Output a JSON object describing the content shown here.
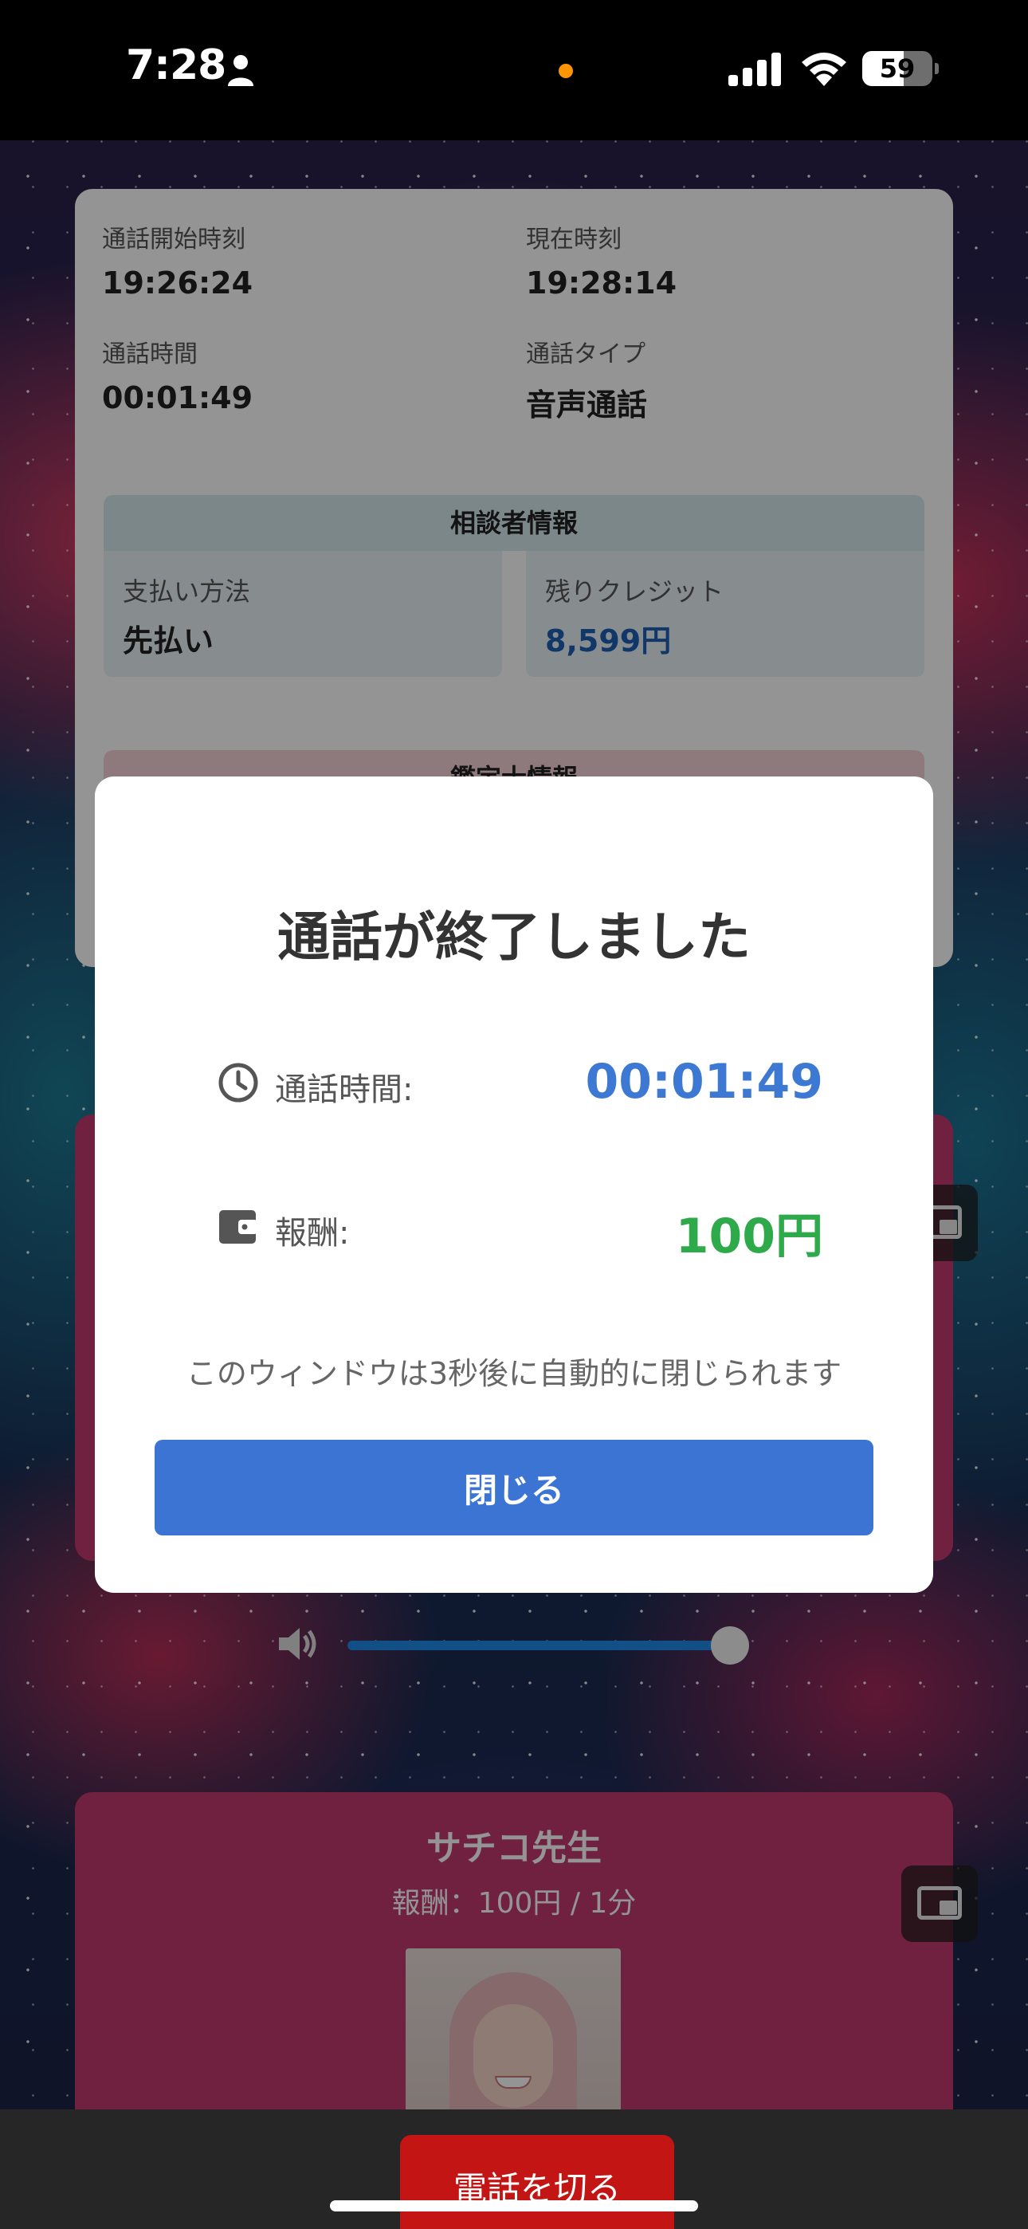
{
  "status_bar": {
    "time": "7:28",
    "battery_percent": "59",
    "battery_level": 0.59
  },
  "call_info": {
    "start_time_label": "通話開始時刻",
    "start_time": "19:26:24",
    "current_time_label": "現在時刻",
    "current_time": "19:28:14",
    "duration_label": "通話時間",
    "duration": "00:01:49",
    "type_label": "通話タイプ",
    "type": "音声通話"
  },
  "consultant_info": {
    "heading": "相談者情報",
    "payment_label": "支払い方法",
    "payment_value": "先払い",
    "credit_label": "残りクレジット",
    "credit_value": "8,599円",
    "credit_color": "#1e5fb4"
  },
  "appraiser_info": {
    "heading": "鑑定士情報"
  },
  "modal": {
    "title": "通話が終了しました",
    "duration_label": "通話時間:",
    "duration_value": "00:01:49",
    "reward_label": "報酬:",
    "reward_value": "100円",
    "auto_close_text": "このウィンドウは3秒後に自動的に閉じられます",
    "close_button": "閉じる",
    "duration_color": "#3d79d3",
    "reward_color": "#2eaa4a",
    "button_color": "#3b74d3"
  },
  "volume": {
    "level": 1.0
  },
  "teacher_card": {
    "name": "サチコ先生",
    "rate": "報酬：100円 / 1分"
  },
  "bottom_bar": {
    "hangup_button": "電話を切る",
    "hangup_color": "#c41515"
  }
}
